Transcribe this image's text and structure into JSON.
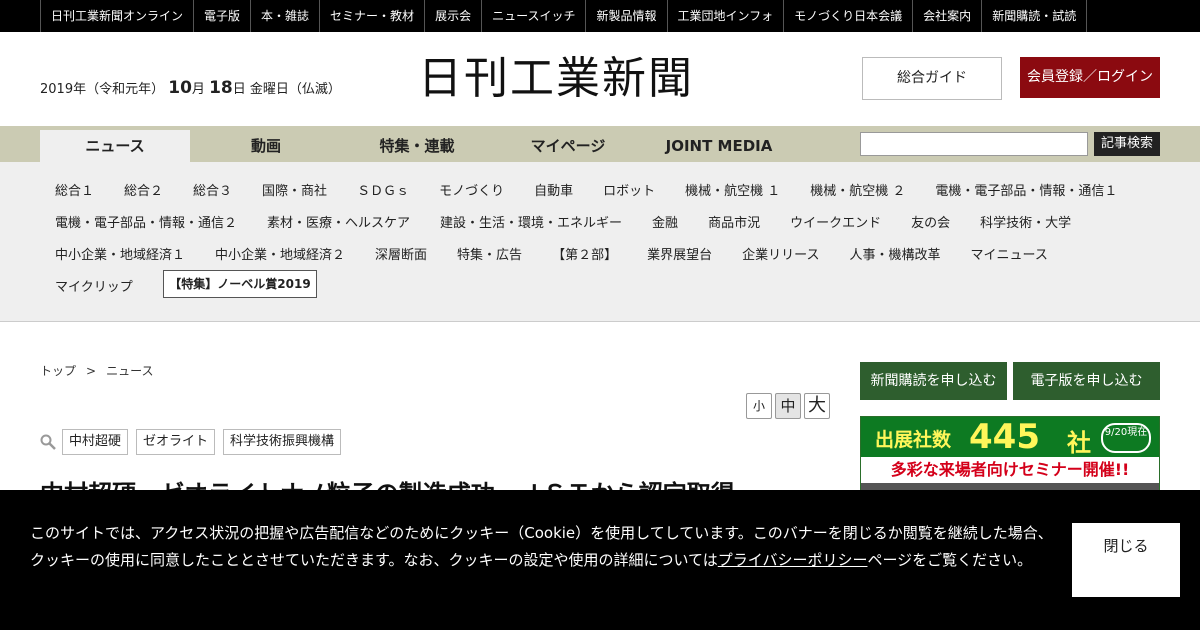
{
  "topbar": {
    "items": [
      "日刊工業新聞オンライン",
      "電子版",
      "本・雑誌",
      "セミナー・教材",
      "展示会",
      "ニュースイッチ",
      "新製品情報",
      "工業団地インフォ",
      "モノづくり日本会議",
      "会社案内",
      "新聞購読・試読"
    ]
  },
  "header": {
    "date_prefix": "2019年（令和元年）",
    "month": "10",
    "month_unit": "月",
    "day": "18",
    "day_suffix": "日 金曜日（仏滅）",
    "logo": "日刊工業新聞",
    "guide_label": "総合ガイド",
    "login_label": "会員登録／ログイン"
  },
  "mainnav": {
    "tabs": [
      "ニュース",
      "動画",
      "特集・連載",
      "マイページ",
      "JOINT MEDIA"
    ],
    "search_label": "記事検索"
  },
  "subnav": {
    "row1": [
      "総合１",
      "総合２",
      "総合３",
      "国際・商社",
      "ＳＤＧｓ",
      "モノづくり",
      "自動車",
      "ロボット",
      "機械・航空機 １",
      "機械・航空機 ２",
      "電機・電子部品・情報・通信１"
    ],
    "row2": [
      "電機・電子部品・情報・通信２",
      "素材・医療・ヘルスケア",
      "建設・生活・環境・エネルギー",
      "金融",
      "商品市況",
      "ウイークエンド",
      "友の会",
      "科学技術・大学"
    ],
    "row3": [
      "中小企業・地域経済１",
      "中小企業・地域経済２",
      "深層断面",
      "特集・広告",
      "【第２部】",
      "業界展望台",
      "企業リリース",
      "人事・機構改革",
      "マイニュース"
    ],
    "row4": [
      "マイクリップ"
    ],
    "special": "【特集】ノーベル賞2019"
  },
  "content": {
    "breadcrumb": [
      "トップ",
      "ニュース"
    ],
    "breadcrumb_sep": ">",
    "font_sizes": [
      "小",
      "中",
      "大"
    ],
    "tags": [
      "中村超硬",
      "ゼオライト",
      "科学技術振興機構"
    ],
    "headline": "中村超硬、ゼオライトナノ粒子の製造成功　ＪＳＴから認定取得"
  },
  "sidebar": {
    "subscribe_label": "新聞購読を申し込む",
    "digital_label": "電子版を申し込む",
    "banner_line1": "出展社数",
    "banner_count": "445",
    "banner_unit": "社",
    "banner_date": "9/20現在",
    "banner_line2": "多彩な来場者向けセミナー開催!!"
  },
  "cookie": {
    "text_before": "このサイトでは、アクセス状況の把握や広告配信などのためにクッキー（Cookie）を使用してしています。このバナーを閉じるか閲覧を継続した場合、クッキーの使用に同意したこととさせていただきます。なお、クッキーの設定や使用の詳細については",
    "link_text": "プライバシーポリシー",
    "text_after": "ページをご覧ください。",
    "close_label": "閉じる"
  },
  "colors": {
    "nav_bg": "#cbcbb3",
    "login_bg": "#8b0a10",
    "side_btn_bg": "#2e5e2e"
  }
}
